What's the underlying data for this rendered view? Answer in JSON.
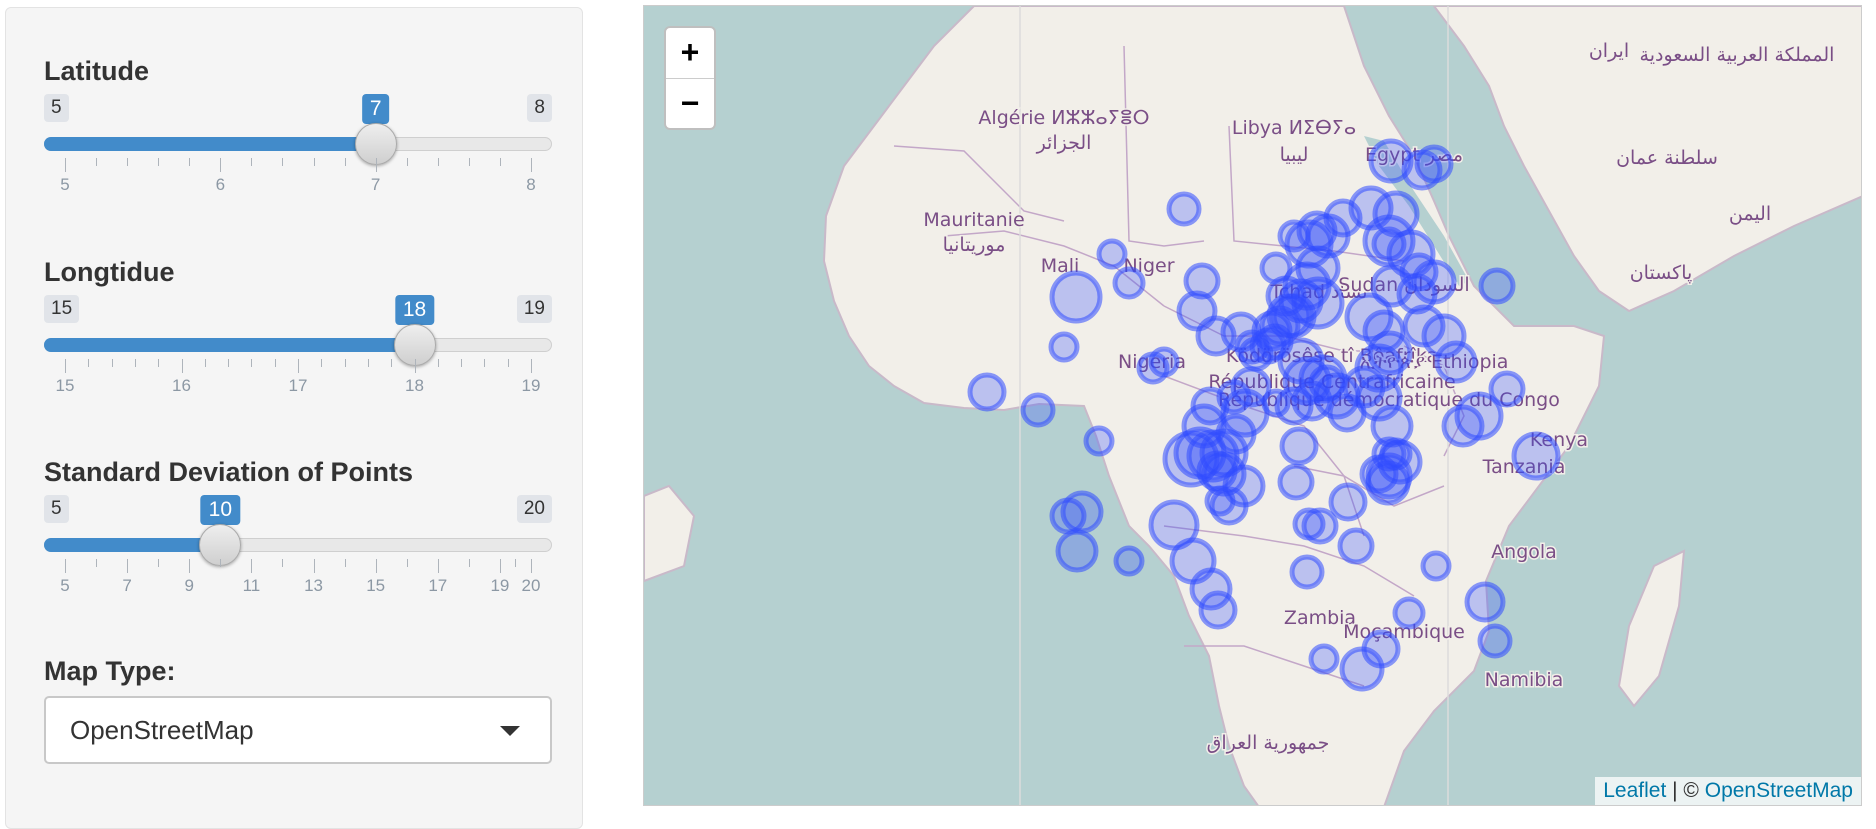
{
  "sidebar": {
    "latitude": {
      "label": "Latitude",
      "min": 5,
      "max": 8,
      "value": 7,
      "ticks": [
        "5",
        "6",
        "7",
        "8"
      ],
      "minor_per_major": 4
    },
    "longitude": {
      "label": "Longtidue",
      "min": 15,
      "max": 19,
      "value": 18,
      "ticks": [
        "15",
        "16",
        "17",
        "18",
        "19"
      ],
      "minor_per_major": 4
    },
    "std_dev": {
      "label": "Standard Deviation of Points",
      "min": 5,
      "max": 20,
      "value": 10,
      "ticks": [
        "5",
        "7",
        "9",
        "11",
        "13",
        "15",
        "17",
        "19",
        "20"
      ],
      "minor_per_major": 1
    },
    "map_type": {
      "label": "Map Type:",
      "selected": "OpenStreetMap"
    }
  },
  "map": {
    "zoom_in": "+",
    "zoom_out": "−",
    "attribution": {
      "leaflet": "Leaflet",
      "sep": " | © ",
      "osm": "OpenStreetMap"
    },
    "marker_color": "#2f4bff",
    "water_color": "#b5d0d0",
    "land_color": "#f2efe9",
    "labels": [
      "Algérie ⵍⵣⵣⴰⵢⴻⵔ",
      "الجزائر",
      "Libya ⵍⵉⴱⵢⴰ",
      "ليبيا",
      "Egypt مصر",
      "Mauritanie",
      "موريتانيا",
      "Mali",
      "Niger",
      "Tchad تشاد",
      "Sudan السودان",
      "Nigeria",
      "Ködörösêse tî Bêafrîka",
      "République Centrafricaine",
      "République démocratique du Congo",
      "ኢትዮጵያ Ethiopia",
      "Kenya",
      "Tanzania",
      "Angola",
      "Zambia",
      "Moçambique",
      "Namibia",
      "جمهورية العراق",
      "ايران",
      "المملكة العربية السعودية",
      "سلطنة عمان",
      "اليمن",
      "پاکستان"
    ]
  }
}
